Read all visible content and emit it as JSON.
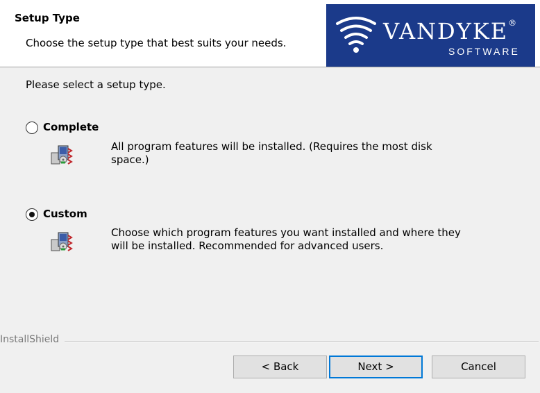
{
  "header": {
    "title": "Setup Type",
    "subtitle": "Choose the setup type that best suits your needs.",
    "logo_brand": "VANDYKE",
    "logo_registered": "®",
    "logo_sub": "SOFTWARE",
    "logo_color": "#1b3a8a"
  },
  "body": {
    "prompt": "Please select a setup type.",
    "options": [
      {
        "label": "Complete",
        "selected": false,
        "description": "All program features will be installed. (Requires the most disk space.)",
        "icon": "installer-package-icon"
      },
      {
        "label": "Custom",
        "selected": true,
        "description": "Choose which program features you want installed and where they will be installed. Recommended for advanced users.",
        "icon": "installer-package-icon"
      }
    ]
  },
  "footer": {
    "brand": "InstallShield",
    "back_label": "< Back",
    "next_label": "Next >",
    "cancel_label": "Cancel"
  }
}
